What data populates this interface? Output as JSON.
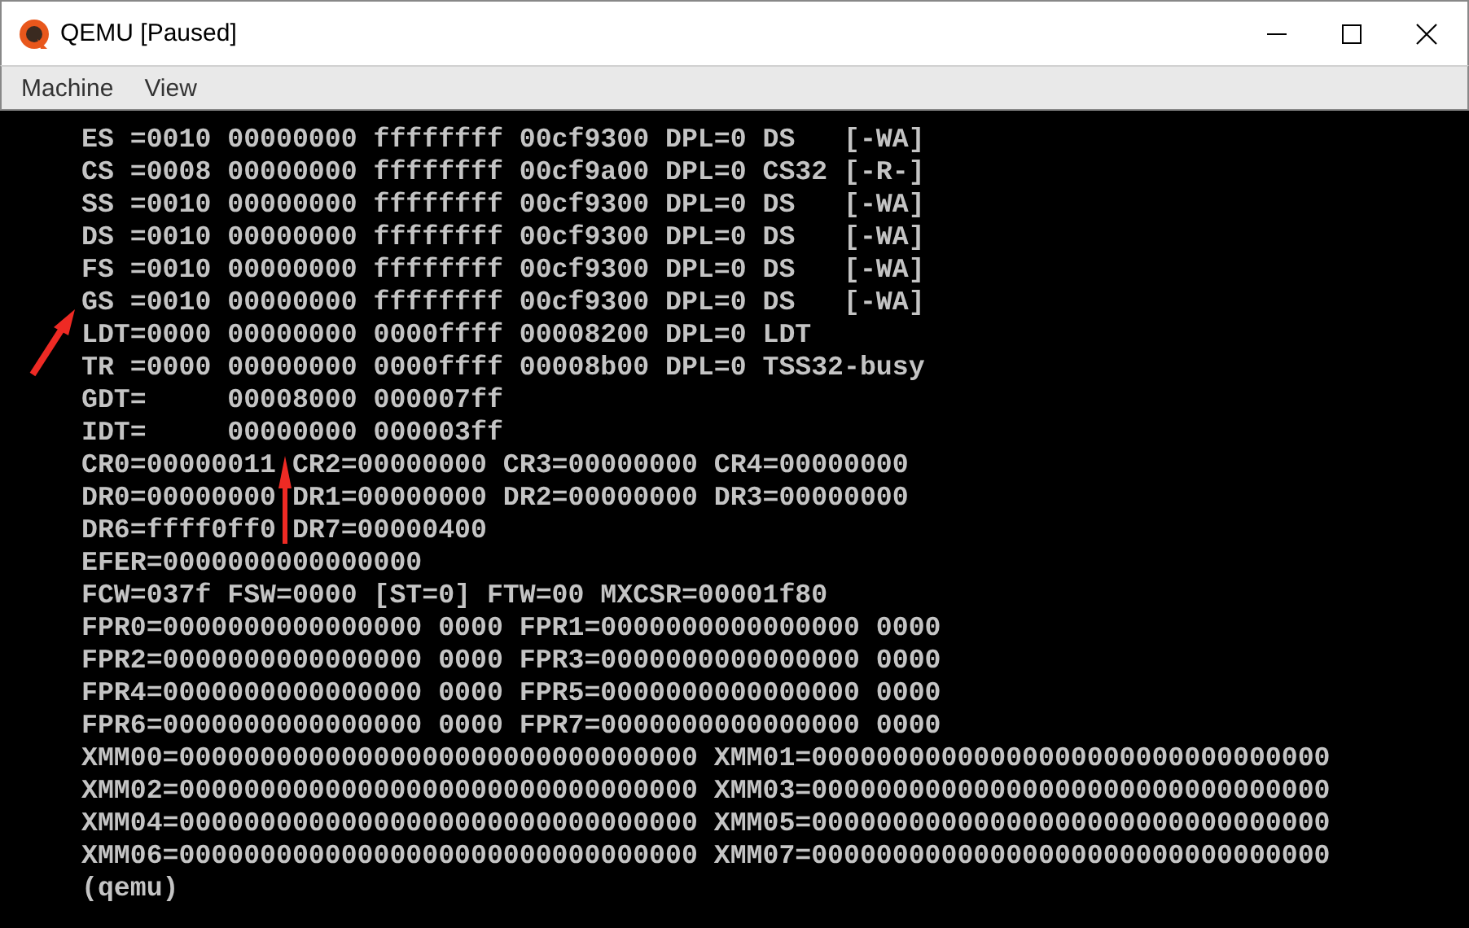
{
  "window": {
    "title": "QEMU [Paused]"
  },
  "menu": [
    {
      "label": "Machine"
    },
    {
      "label": "View"
    }
  ],
  "console": {
    "lines": [
      "ES =0010 00000000 ffffffff 00cf9300 DPL=0 DS   [-WA]",
      "CS =0008 00000000 ffffffff 00cf9a00 DPL=0 CS32 [-R-]",
      "SS =0010 00000000 ffffffff 00cf9300 DPL=0 DS   [-WA]",
      "DS =0010 00000000 ffffffff 00cf9300 DPL=0 DS   [-WA]",
      "FS =0010 00000000 ffffffff 00cf9300 DPL=0 DS   [-WA]",
      "GS =0010 00000000 ffffffff 00cf9300 DPL=0 DS   [-WA]",
      "LDT=0000 00000000 0000ffff 00008200 DPL=0 LDT",
      "TR =0000 00000000 0000ffff 00008b00 DPL=0 TSS32-busy",
      "GDT=     00008000 000007ff",
      "IDT=     00000000 000003ff",
      "CR0=00000011 CR2=00000000 CR3=00000000 CR4=00000000",
      "DR0=00000000 DR1=00000000 DR2=00000000 DR3=00000000",
      "DR6=ffff0ff0 DR7=00000400",
      "EFER=0000000000000000",
      "FCW=037f FSW=0000 [ST=0] FTW=00 MXCSR=00001f80",
      "FPR0=0000000000000000 0000 FPR1=0000000000000000 0000",
      "FPR2=0000000000000000 0000 FPR3=0000000000000000 0000",
      "FPR4=0000000000000000 0000 FPR5=0000000000000000 0000",
      "FPR6=0000000000000000 0000 FPR7=0000000000000000 0000",
      "XMM00=00000000000000000000000000000000 XMM01=00000000000000000000000000000000",
      "XMM02=00000000000000000000000000000000 XMM03=00000000000000000000000000000000",
      "XMM04=00000000000000000000000000000000 XMM05=00000000000000000000000000000000",
      "XMM06=00000000000000000000000000000000 XMM07=00000000000000000000000000000000",
      "(qemu)"
    ]
  }
}
